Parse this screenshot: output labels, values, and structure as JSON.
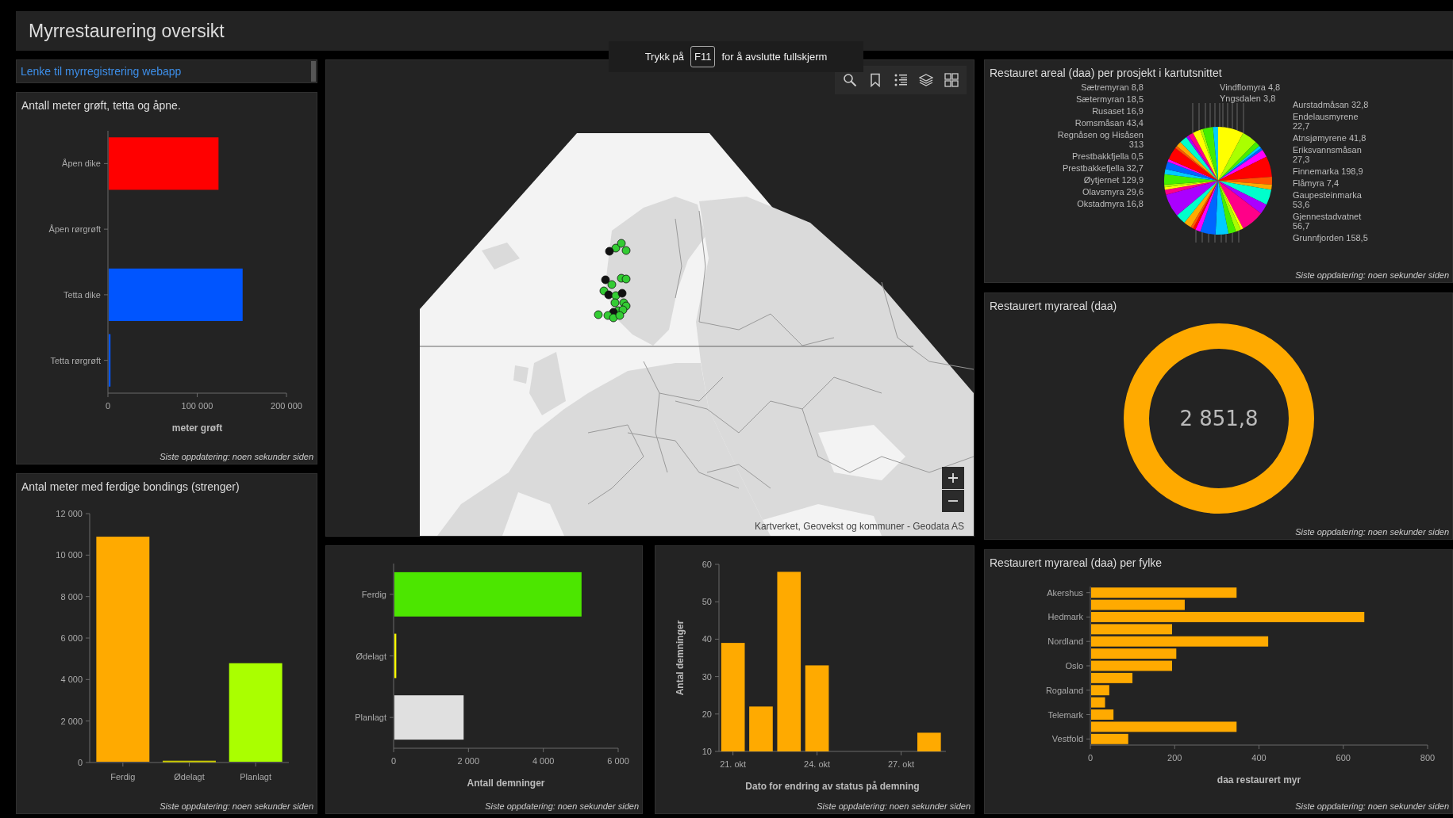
{
  "header": {
    "title": "Myrrestaurering oversikt"
  },
  "fullscreen_notice": {
    "before": "Trykk på",
    "key": "F11",
    "after": "for å avslutte fullskjerm"
  },
  "link": {
    "text": "Lenke til myrregistrering webapp"
  },
  "ditch_panel": {
    "title": "Antall meter grøft, tetta og åpne.",
    "chart_data": {
      "type": "bar",
      "orientation": "horizontal",
      "xlabel": "meter grøft",
      "categories": [
        "Åpen dike",
        "Åpen rørgrøft",
        "Tetta dike",
        "Tetta rørgrøft"
      ],
      "values": [
        123000,
        0,
        150000,
        2000
      ],
      "colors": [
        "#ff0000",
        "#cccccc",
        "#0055ff",
        "#0055ff"
      ],
      "xlim": [
        0,
        200000
      ],
      "xticks": [
        {
          "value": 0,
          "label": "0"
        },
        {
          "value": 100000,
          "label": "100 000"
        },
        {
          "value": 200000,
          "label": "200 000"
        }
      ]
    },
    "footnote": "Siste oppdatering: noen sekunder siden"
  },
  "bonding_panel": {
    "title": "Antal meter med ferdige bondings (strenger)",
    "chart_data": {
      "type": "bar",
      "orientation": "vertical",
      "categories": [
        "Ferdig",
        "Ødelagt",
        "Planlagt"
      ],
      "values": [
        10850,
        50,
        4750
      ],
      "colors": [
        "#ffaa00",
        "#cccc00",
        "#aaff00"
      ],
      "ylim": [
        0,
        12000
      ],
      "yticks": [
        {
          "value": 0,
          "label": "0"
        },
        {
          "value": 2000,
          "label": "2 000"
        },
        {
          "value": 4000,
          "label": "4 000"
        },
        {
          "value": 6000,
          "label": "6 000"
        },
        {
          "value": 8000,
          "label": "8 000"
        },
        {
          "value": 10000,
          "label": "10 000"
        },
        {
          "value": 12000,
          "label": "12 000"
        }
      ]
    },
    "footnote": "Siste oppdatering: noen sekunder siden"
  },
  "map": {
    "attribution": "Kartverket, Geovekst og kommuner - Geodata AS"
  },
  "dam_status_panel": {
    "chart_data": {
      "type": "bar",
      "orientation": "horizontal",
      "xlabel": "Antall demninger",
      "categories": [
        "Ferdig",
        "Ødelagt",
        "Planlagt"
      ],
      "values": [
        5000,
        50,
        1850
      ],
      "colors": [
        "#4ce600",
        "#ffff00",
        "#e0e0e0"
      ],
      "xlim": [
        0,
        6000
      ],
      "xticks": [
        {
          "value": 0,
          "label": "0"
        },
        {
          "value": 2000,
          "label": "2 000"
        },
        {
          "value": 4000,
          "label": "4 000"
        },
        {
          "value": 6000,
          "label": "6 000"
        }
      ]
    },
    "footnote": "Siste oppdatering: noen sekunder siden"
  },
  "dam_date_panel": {
    "chart_data": {
      "type": "bar",
      "orientation": "vertical",
      "xlabel": "Dato for endring av status på demning",
      "ylabel": "Antal demninger",
      "x": [
        21,
        22,
        23,
        24,
        28
      ],
      "series": [
        {
          "color": "#ffaa00",
          "values": [
            39,
            22,
            58,
            33,
            15
          ]
        }
      ],
      "xlim": [
        20.5,
        28.6
      ],
      "ylim": [
        10,
        60
      ],
      "xticks": [
        {
          "value": 21,
          "label": "21. okt"
        },
        {
          "value": 24,
          "label": "24. okt"
        },
        {
          "value": 27,
          "label": "27. okt"
        }
      ],
      "yticks": [
        10,
        20,
        30,
        40,
        50,
        60
      ]
    },
    "footnote": "Siste oppdatering: noen sekunder siden"
  },
  "pie_panel": {
    "title": "Restauret areal (daa) per prosjekt i kartutsnittet",
    "left_labels": [
      "Sætremyran 8,8",
      "Sætermyran 18,5",
      "Rusaset 16,9",
      "Romsmåsan 43,4",
      "Regnåsen og Hisåsen 313",
      "Prestbakkfjella 0,5",
      "Prestbakkefjella 32,7",
      "Øytjernet 129,9",
      "Olavsmyra 29,6",
      "Okstadmyra 16,8"
    ],
    "top_labels": [
      "Vindflomyra 4,8",
      "Yngsdalen 3,8"
    ],
    "right_labels": [
      "Aurstadmåsan 32,8",
      "Endelausmyrene 22,7",
      "Atnsjømyrene 41,8",
      "Eriksvannsmåsan 27,3",
      "Finnemarka 198,9",
      "Flåmyra 7,4",
      "Gaupesteinmarka 53,6",
      "Gjennestadvatnet 56,7",
      "Grunnfjorden 158,5"
    ],
    "footnote": "Siste oppdatering: noen sekunder siden"
  },
  "total_panel": {
    "title": "Restaurert myrareal (daa)",
    "value": "2 851,8",
    "footnote": "Siste oppdatering: noen sekunder siden"
  },
  "county_panel": {
    "title": "Restaurert myrareal (daa) per fylke",
    "chart_data": {
      "type": "bar",
      "orientation": "horizontal",
      "xlabel": "daa restaurert myr",
      "categories": [
        "Akershus",
        null,
        "Hedmark",
        null,
        "Nordland",
        null,
        "Oslo",
        null,
        "Rogaland",
        null,
        "Telemark",
        null,
        "Vestfold"
      ],
      "series": [
        {
          "color": "#ffaa00",
          "values": [
            345,
            222,
            648,
            192,
            420,
            202,
            192,
            98,
            43,
            33,
            53,
            345,
            88
          ]
        }
      ],
      "xlim": [
        0,
        800
      ],
      "xticks": [
        0,
        200,
        400,
        600,
        800
      ]
    },
    "footnote": "Siste oppdatering: noen sekunder siden"
  }
}
